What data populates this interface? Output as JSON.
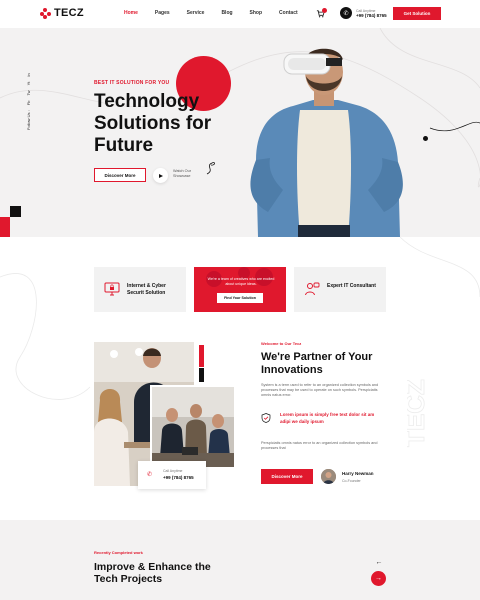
{
  "brand": {
    "name": "TECZ",
    "accent": "#e0182d",
    "dark": "#111111"
  },
  "nav": {
    "items": [
      {
        "label": "Home",
        "active": true
      },
      {
        "label": "Pages",
        "active": false
      },
      {
        "label": "Service",
        "active": false
      },
      {
        "label": "Blog",
        "active": false
      },
      {
        "label": "Shop",
        "active": false
      },
      {
        "label": "Contact",
        "active": false
      }
    ],
    "cart_icon": "cart-icon",
    "call_label": "Call Anytime",
    "call_number": "+99 (784) 8765",
    "cta_label": "Get Solution"
  },
  "hero": {
    "social_label": "Follow Us :",
    "social_icons": [
      "Fb",
      "Tw",
      "Yt",
      "In"
    ],
    "tag": "BEST IT SOLUTION FOR YOU",
    "title": "Technology Solutions for Future",
    "discover_label": "Discover More",
    "watch_label": "Watch Our Showcase"
  },
  "features": [
    {
      "title": "Internet & Cyber Securit Solution",
      "icon": "monitor-lock-icon"
    },
    {
      "text": "We're a team of creatives who are excited about unique ideas.",
      "button": "Find Your Solution"
    },
    {
      "title": "Expert IT Consultant",
      "icon": "consultant-icon"
    }
  ],
  "about": {
    "tag": "Welcome to Our Tecz",
    "title": "We're Partner of Your Innovations",
    "text1": "System is a term used to refer to an organized collection symbols and processes that may be used to operate on such symbols. Perspiciatis omnis natus error.",
    "highlight": "Lorem ipsum is simply free text dolor sit am adipi we daily ipsum",
    "text2": "Perspiciatis omnis natus error to an organized collection symbols and processes that",
    "button": "Discover More",
    "author_name": "Harry Newman",
    "author_role": "Co-Founder",
    "call_label": "Call Anytime",
    "call_number": "+99 (784) 8765",
    "watermark": "TECZ"
  },
  "projects": {
    "tag": "Recently Completed work",
    "title": "Improve & Enhance the Tech Projects"
  }
}
